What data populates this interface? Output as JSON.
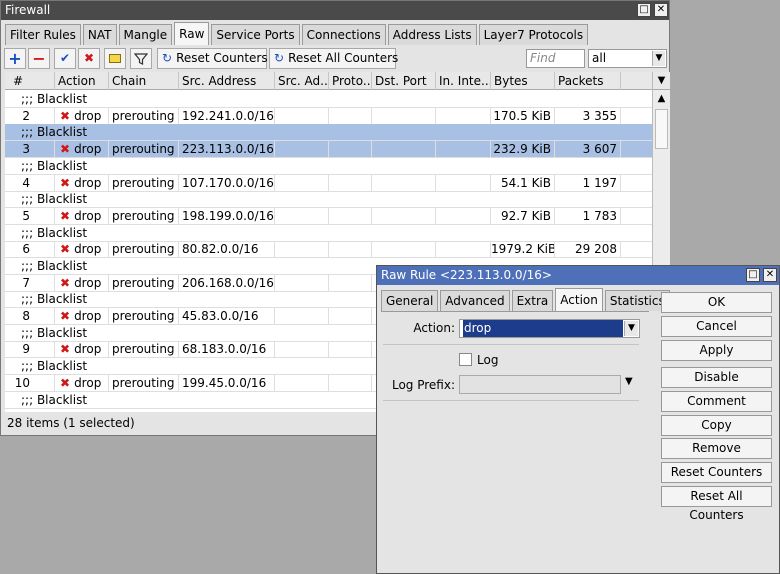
{
  "firewall": {
    "title": "Firewall",
    "tabs": [
      "Filter Rules",
      "NAT",
      "Mangle",
      "Raw",
      "Service Ports",
      "Connections",
      "Address Lists",
      "Layer7 Protocols"
    ],
    "selected_tab": "Raw",
    "toolbar": {
      "reset_counters": "Reset Counters",
      "reset_all_counters": "Reset All Counters",
      "find_placeholder": "Find",
      "filter_value": "all"
    },
    "columns": [
      "#",
      "Action",
      "Chain",
      "Src. Address",
      "Src. Ad...",
      "Proto...",
      "Dst. Port",
      "In. Inte...",
      "Bytes",
      "Packets"
    ],
    "comment": ";;; Blacklist",
    "rows": [
      {
        "num": "2",
        "action": "drop",
        "chain": "prerouting",
        "src": "192.241.0.0/16",
        "bytes": "170.5 KiB",
        "packets": "3 355",
        "selected": false
      },
      {
        "num": "3",
        "action": "drop",
        "chain": "prerouting",
        "src": "223.113.0.0/16",
        "bytes": "232.9 KiB",
        "packets": "3 607",
        "selected": true
      },
      {
        "num": "4",
        "action": "drop",
        "chain": "prerouting",
        "src": "107.170.0.0/16",
        "bytes": "54.1 KiB",
        "packets": "1 197",
        "selected": false
      },
      {
        "num": "5",
        "action": "drop",
        "chain": "prerouting",
        "src": "198.199.0.0/16",
        "bytes": "92.7 KiB",
        "packets": "1 783",
        "selected": false
      },
      {
        "num": "6",
        "action": "drop",
        "chain": "prerouting",
        "src": "80.82.0.0/16",
        "bytes": "1979.2 KiB",
        "packets": "29 208",
        "selected": false
      },
      {
        "num": "7",
        "action": "drop",
        "chain": "prerouting",
        "src": "206.168.0.0/16",
        "bytes": "",
        "packets": "",
        "selected": false
      },
      {
        "num": "8",
        "action": "drop",
        "chain": "prerouting",
        "src": "45.83.0.0/16",
        "bytes": "",
        "packets": "",
        "selected": false
      },
      {
        "num": "9",
        "action": "drop",
        "chain": "prerouting",
        "src": "68.183.0.0/16",
        "bytes": "",
        "packets": "",
        "selected": false
      },
      {
        "num": "10",
        "action": "drop",
        "chain": "prerouting",
        "src": "199.45.0.0/16",
        "bytes": "",
        "packets": "",
        "selected": false
      }
    ],
    "status": "28 items (1 selected)"
  },
  "dialog": {
    "title": "Raw Rule <223.113.0.0/16>",
    "tabs": [
      "General",
      "Advanced",
      "Extra",
      "Action",
      "Statistics"
    ],
    "selected_tab": "Action",
    "action_label": "Action:",
    "action_value": "drop",
    "log_label": "Log",
    "log_checked": false,
    "log_prefix_label": "Log Prefix:",
    "log_prefix_value": "",
    "buttons": [
      "OK",
      "Cancel",
      "Apply",
      "Disable",
      "Comment",
      "Copy",
      "Remove",
      "Reset Counters",
      "Reset All Counters"
    ]
  },
  "colors": {
    "selection": "#a8c0e4",
    "drop_icon": "#d01818",
    "active_title": "#4d70b8"
  }
}
